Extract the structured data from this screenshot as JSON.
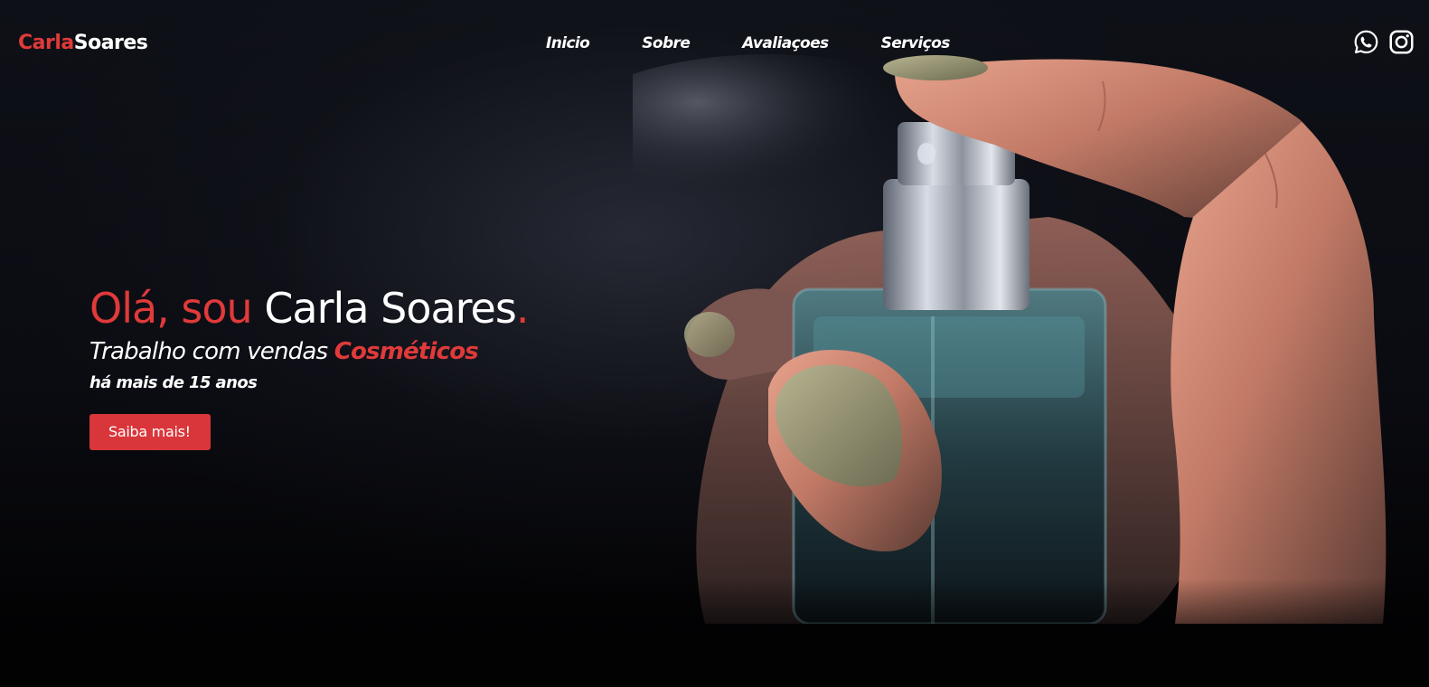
{
  "header": {
    "logo_first": "Carla",
    "logo_second": "Soares",
    "nav": [
      "Inicio",
      "Sobre",
      "Avaliaçoes",
      "Serviços"
    ],
    "social_icons": [
      "whatsapp-icon",
      "instagram-icon"
    ]
  },
  "hero": {
    "greeting_red": "Olá, sou ",
    "name": "Carla Soares",
    "name_dot": ".",
    "subtitle_prefix": "Trabalho com vendas ",
    "subtitle_accent": "Cosméticos",
    "since": "há mais de 15 anos",
    "cta_label": "Saiba mais!"
  },
  "colors": {
    "accent": "#e03a3a",
    "button": "#d9363b",
    "background": "#0b0c12",
    "text": "#ffffff"
  }
}
